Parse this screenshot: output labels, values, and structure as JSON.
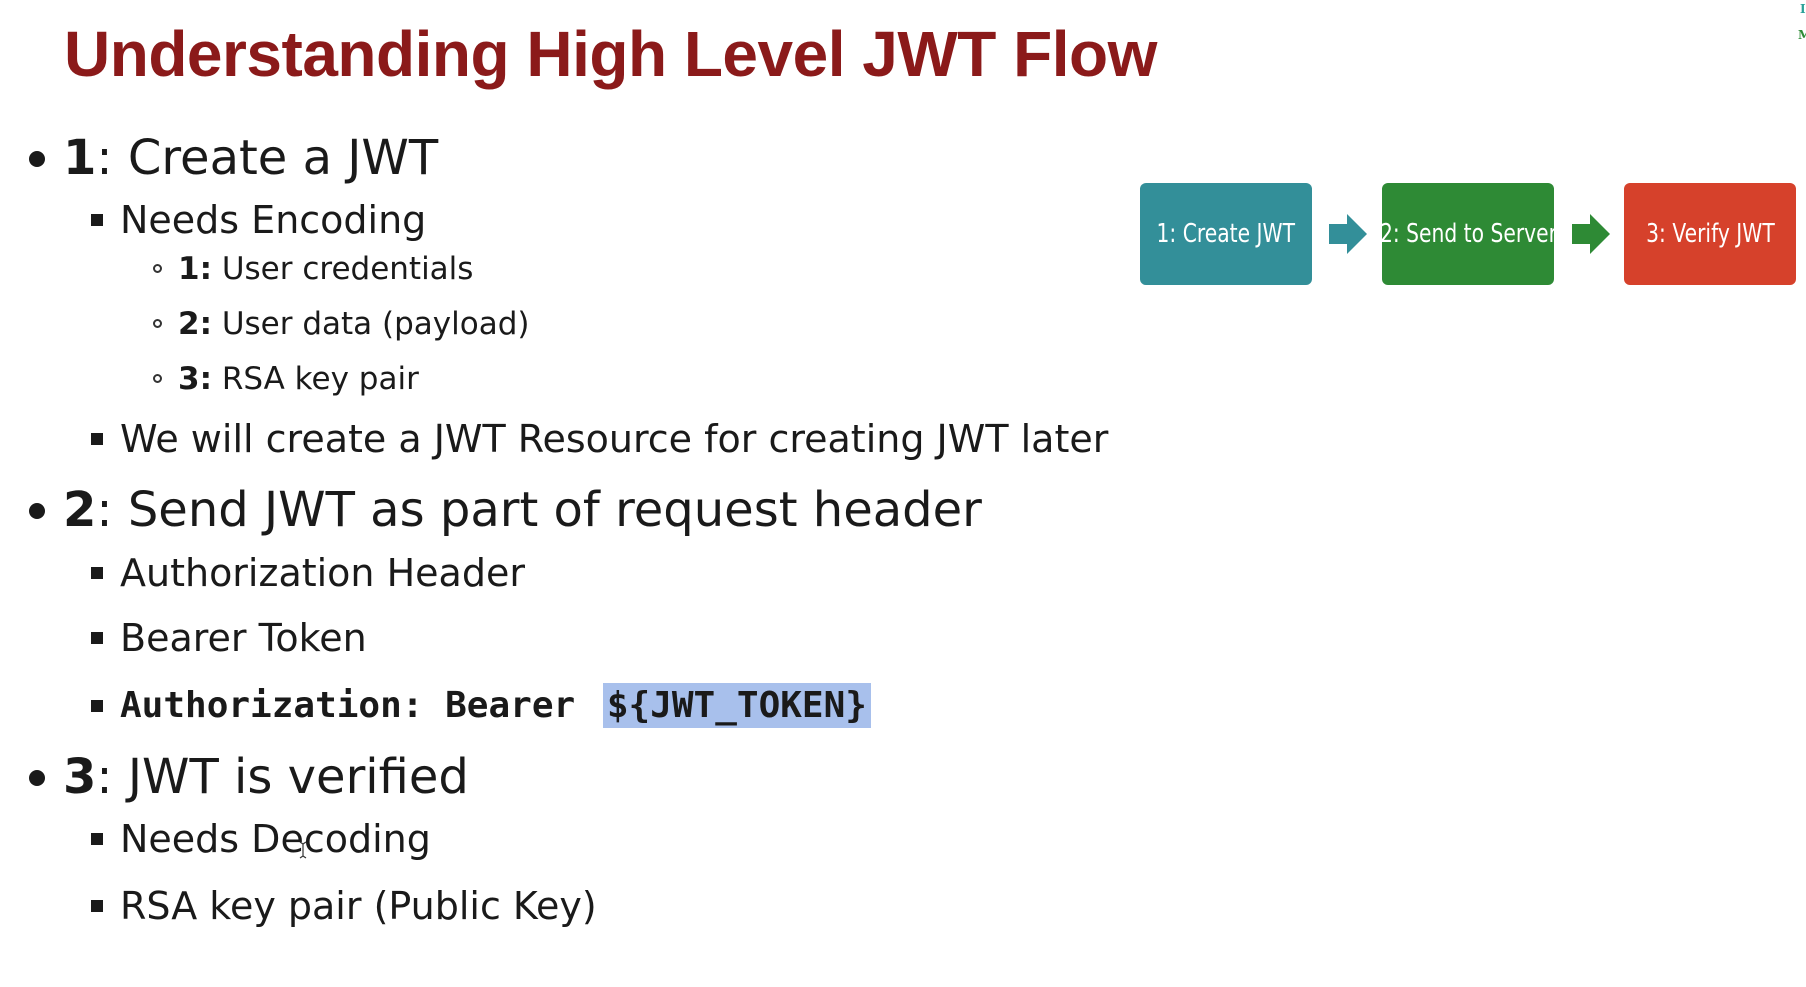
{
  "title": "Understanding High Level JWT Flow",
  "steps": [
    {
      "num": "1",
      "text": ": Create a JWT",
      "subitems": [
        {
          "text": "Needs Encoding",
          "subitems": [
            {
              "num": "1:",
              "text": " User credentials"
            },
            {
              "num": "2:",
              "text": " User data (payload)"
            },
            {
              "num": "3:",
              "text": " RSA key pair"
            }
          ]
        },
        {
          "text": "We will create a JWT Resource for creating JWT later"
        }
      ]
    },
    {
      "num": "2",
      "text": ": Send JWT as part of request header",
      "subitems": [
        {
          "text": "Authorization Header"
        },
        {
          "text": "Bearer Token"
        },
        {
          "code": "Authorization:",
          "code2": "Bearer",
          "code_highlight": "${JWT_TOKEN}"
        }
      ]
    },
    {
      "num": "3",
      "text": ": JWT is verified",
      "subitems": [
        {
          "text": "Needs Decoding"
        },
        {
          "text": "RSA key pair (Public Key)"
        }
      ]
    }
  ],
  "flow": [
    {
      "label": "1: Create JWT",
      "color": "#338f99"
    },
    {
      "label": "2: Send to Server",
      "color": "#2e8a35"
    },
    {
      "label": "3: Verify JWT",
      "color": "#d6412b"
    }
  ],
  "flow_arrow_colors": [
    "#338f99",
    "#2e8a35"
  ],
  "corner": {
    "line1": "I",
    "line2": "M",
    "color1": "#2aa198",
    "color2": "#2e8a35"
  }
}
